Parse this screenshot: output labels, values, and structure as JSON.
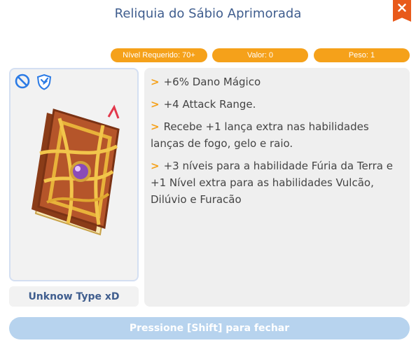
{
  "window": {
    "title": "Reliquia do Sábio Aprimorada",
    "close_icon": "close-icon"
  },
  "badges": {
    "level": "Nível Requerido: 70+",
    "value": "Valor: 0",
    "weight": "Peso: 1"
  },
  "item": {
    "icons": [
      "forbidden-icon",
      "shield-icon"
    ],
    "image": "spellbook-icon",
    "type": "Unknow Type xD"
  },
  "description": {
    "bullet": ">",
    "lines": [
      "+6% Dano Mágico",
      "+4 Attack Range.",
      "Recebe +1 lança extra nas habilidades lanças de fogo, gelo e raio.",
      "+3 níveis para a habilidade Fúria da Terra e +1 Nível extra para as habilidades Vulcão, Dilúvio e Furacão"
    ]
  },
  "footer": {
    "label": "Pressione [Shift] para fechar"
  },
  "colors": {
    "accent": "#f5a11a",
    "title": "#3f5d8e",
    "close": "#e85a1b",
    "footer": "#b7d3ee"
  }
}
